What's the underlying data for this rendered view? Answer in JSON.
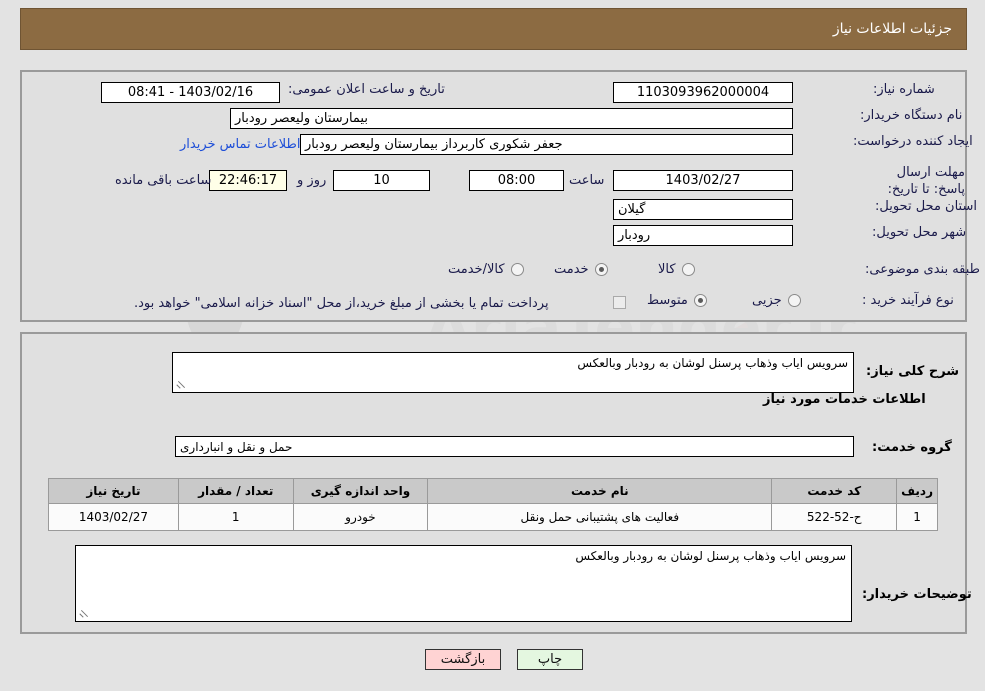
{
  "page": {
    "title": "جزئیات اطلاعات نیاز",
    "direction": "rtl"
  },
  "request_info": {
    "need_number_label": "شماره نیاز:",
    "need_number_value": "1103093962000004",
    "buyer_org_label": "نام دستگاه خریدار:",
    "buyer_org_value": "بیمارستان ولیعصر رودبار",
    "creator_label": "ایجاد کننده درخواست:",
    "creator_value": "جعفر شکوری کاربرداز بیمارستان ولیعصر رودبار",
    "contact_link": "اطلاعات تماس خریدار",
    "deadline_label": "مهلت ارسال پاسخ: تا تاریخ:",
    "deadline_date": "1403/02/27",
    "deadline_time_label": "ساعت",
    "deadline_time": "08:00",
    "remaining_days": "10",
    "remaining_days_label": "روز و",
    "remaining_time": "22:46:17",
    "remaining_time_label": "ساعت باقی مانده",
    "announce_label": "تاریخ و ساعت اعلان عمومی:",
    "announce_value": "1403/02/16 - 08:41",
    "province_label": "استان محل تحویل:",
    "province_value": "گیلان",
    "city_label": "شهر محل تحویل:",
    "city_value": "رودبار"
  },
  "category": {
    "label": "طبقه بندی موضوعی:",
    "options": [
      {
        "label": "کالا",
        "selected": false
      },
      {
        "label": "خدمت",
        "selected": true
      },
      {
        "label": "کالا/خدمت",
        "selected": false
      }
    ]
  },
  "purchase_process": {
    "label": "نوع فرآیند خرید :",
    "options": [
      {
        "label": "جزیی",
        "selected": false
      },
      {
        "label": "متوسط",
        "selected": true
      }
    ],
    "treasury_checkbox_checked": false,
    "treasury_note": "پرداخت تمام یا بخشی از مبلغ خرید،از محل \"اسناد خزانه اسلامی\" خواهد بود."
  },
  "general_description": {
    "label": "شرح کلی نیاز:",
    "value": "سرویس ایاب وذهاب پرسنل لوشان به رودبار وبالعکس"
  },
  "services_section": {
    "heading": "اطلاعات خدمات مورد نیاز",
    "group_label": "گروه خدمت:",
    "group_value": "حمل و نقل و انبارداری",
    "table": {
      "headers": [
        "ردیف",
        "کد خدمت",
        "نام خدمت",
        "واحد اندازه گیری",
        "تعداد / مقدار",
        "تاریخ نیاز"
      ],
      "rows": [
        {
          "index": "1",
          "code": "ح-52-522",
          "name": "فعالیت های پشتیبانی حمل ونقل",
          "unit": "خودرو",
          "quantity": "1",
          "need_date": "1403/02/27"
        }
      ]
    }
  },
  "buyer_notes": {
    "label": "توضیحات خریدار:",
    "value": "سرویس ایاب وذهاب پرسنل لوشان به رودبار وبالعکس"
  },
  "footer": {
    "back_button": "بازگشت",
    "print_button": "چاپ"
  },
  "colors": {
    "header_bg": "#8c6b42",
    "page_bg": "#e3e3e3",
    "panel_bg": "#e0e0e0",
    "link": "#1d4ed8",
    "label": "#1b1b4b",
    "back_button_bg": "#ffd3d3",
    "print_button_bg": "#e4f7e0",
    "countdown_bg": "#ffffe8",
    "table_header_bg": "#c9c9c9"
  },
  "watermark": {
    "text": "AriaTender.ir"
  }
}
